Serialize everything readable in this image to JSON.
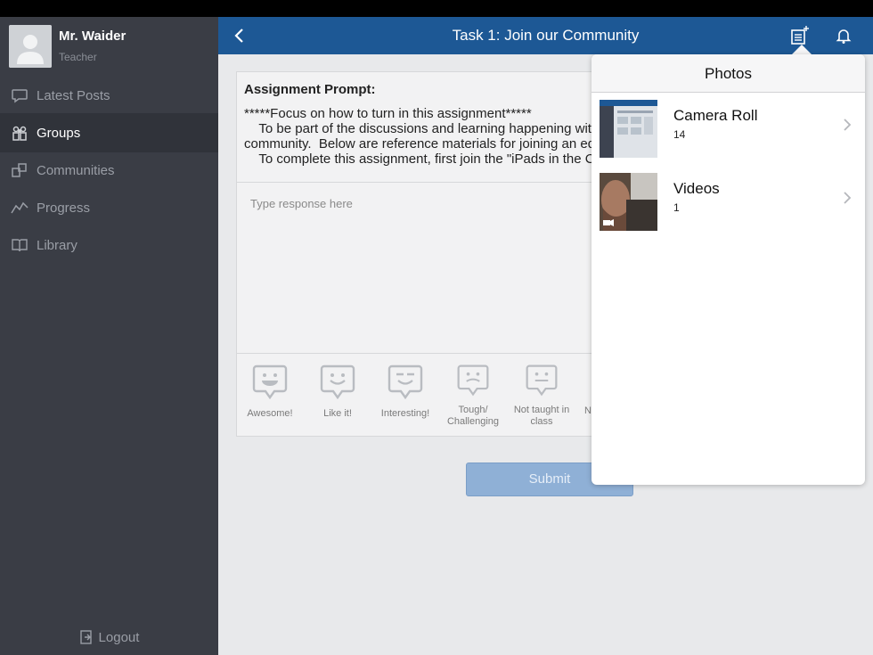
{
  "profile": {
    "name": "Mr. Waider",
    "role": "Teacher"
  },
  "sidebar": {
    "items": [
      {
        "label": "Latest Posts",
        "icon": "speech-bubble-icon"
      },
      {
        "label": "Groups",
        "icon": "groups-icon"
      },
      {
        "label": "Communities",
        "icon": "communities-icon"
      },
      {
        "label": "Progress",
        "icon": "progress-chart-icon"
      },
      {
        "label": "Library",
        "icon": "book-icon"
      }
    ],
    "logout": "Logout"
  },
  "header": {
    "title": "Task 1: Join our Community"
  },
  "assignment": {
    "prompt_label": "Assignment Prompt:",
    "prompt_lines": [
      "*****Focus on how to turn in this assignment*****",
      "    To be part of the discussions and learning happening with",
      "community.  Below are reference materials for joining an edm",
      "    To complete this assignment, first join the \"iPads in the C"
    ],
    "response_placeholder": "Type response here"
  },
  "reactions": [
    {
      "label": "Awesome!"
    },
    {
      "label": "Like it!"
    },
    {
      "label": "Interesting!"
    },
    {
      "label": "Tough/ Challenging"
    },
    {
      "label": "Not taught in class"
    },
    {
      "label": "N"
    }
  ],
  "submit_label": "Submit",
  "photos": {
    "title": "Photos",
    "albums": [
      {
        "name": "Camera Roll",
        "count": "14"
      },
      {
        "name": "Videos",
        "count": "1"
      }
    ]
  },
  "colors": {
    "sidebar_bg": "#3a3d45",
    "header_bg": "#1d5895",
    "submit_bg": "#8fb0d6"
  }
}
